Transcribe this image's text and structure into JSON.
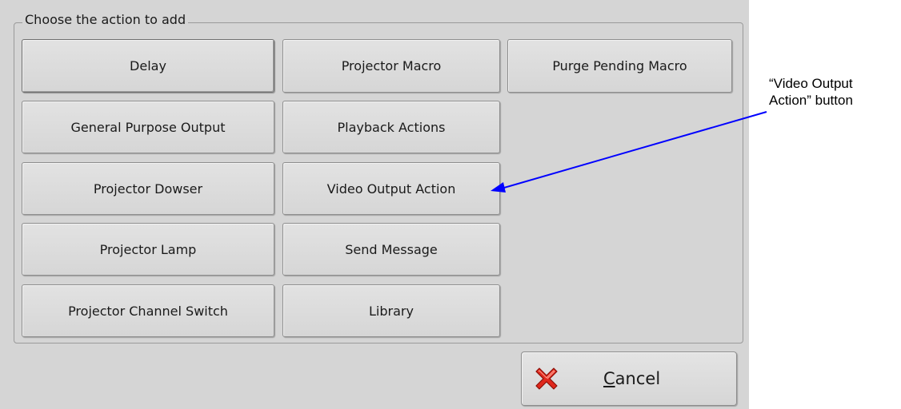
{
  "dialog": {
    "group_title": "Choose the action to add",
    "actions": {
      "delay": "Delay",
      "projector_macro": "Projector Macro",
      "purge_pending_macro": "Purge Pending Macro",
      "general_purpose_output": "General Purpose Output",
      "playback_actions": "Playback Actions",
      "projector_dowser": "Projector Dowser",
      "video_output_action": "Video Output Action",
      "projector_lamp": "Projector Lamp",
      "send_message": "Send Message",
      "projector_channel_switch": "Projector Channel Switch",
      "library": "Library"
    },
    "cancel": {
      "mnemonic": "C",
      "rest": "ancel",
      "icon": "red-x-icon"
    }
  },
  "annotation": {
    "line1": "“Video Output",
    "line2": "Action” button",
    "arrow_color": "#0000ff"
  },
  "colors": {
    "dialog_bg": "#d5d5d5",
    "button_bg": "#dcdcdc",
    "cancel_icon": "#e0281c"
  }
}
